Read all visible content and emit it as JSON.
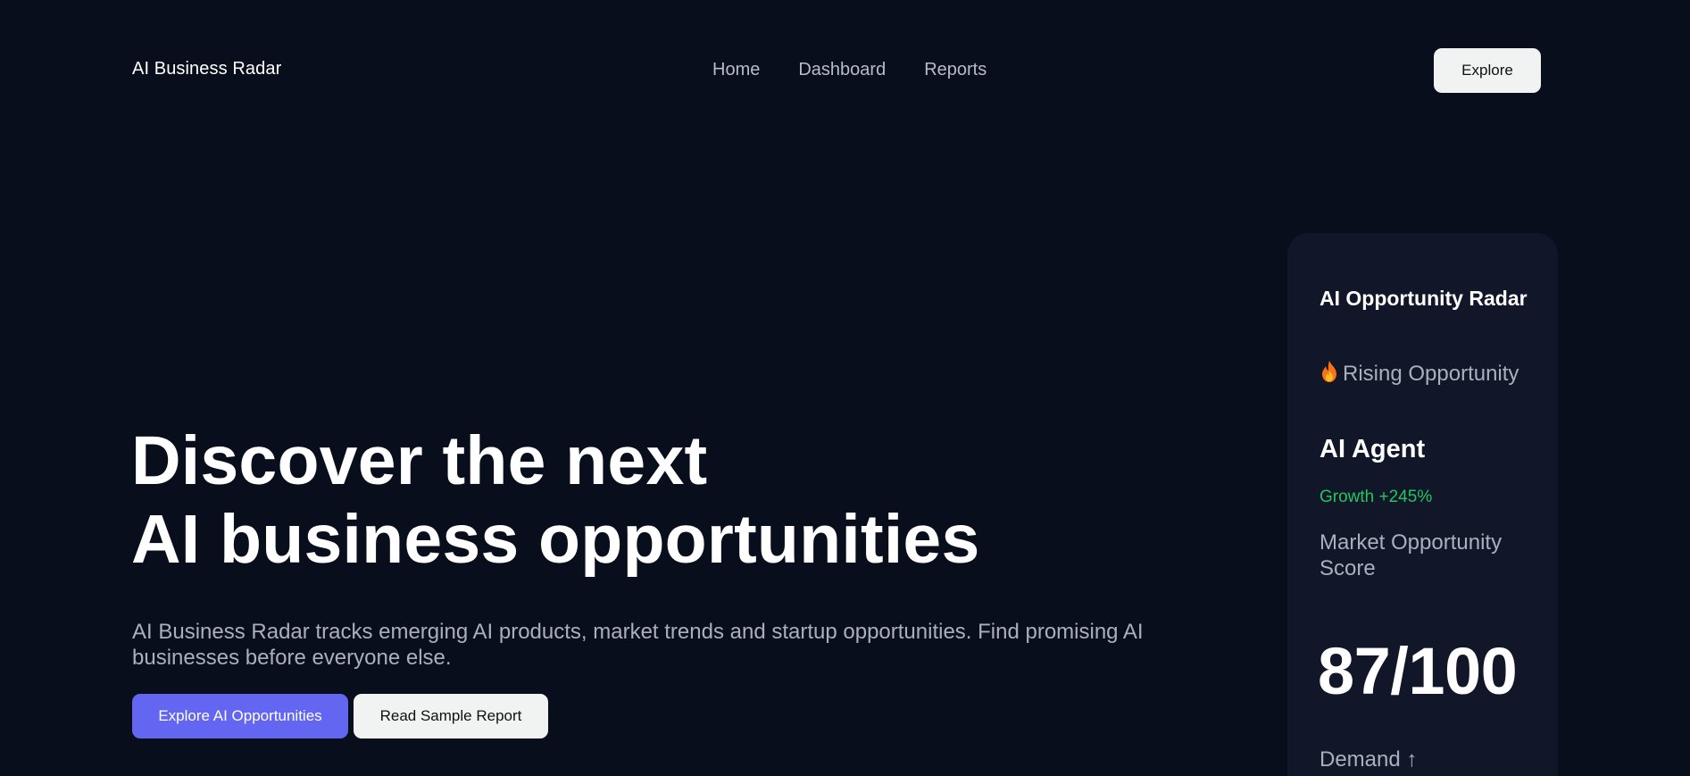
{
  "header": {
    "brand": "AI Business Radar",
    "nav": [
      "Home",
      "Dashboard",
      "Reports"
    ],
    "explore_label": "Explore"
  },
  "hero": {
    "title_line1": "Discover the next",
    "title_line2": "AI business opportunities",
    "subtitle": "AI Business Radar tracks emerging AI products, market trends and startup opportunities. Find promising AI businesses before everyone else.",
    "primary_cta": "Explore AI Opportunities",
    "secondary_cta": "Read Sample Report"
  },
  "card": {
    "title": "AI Opportunity Radar",
    "rising_icon": "fire-icon",
    "rising_label": "Rising Opportunity",
    "category": "AI Agent",
    "growth": "Growth +245%",
    "score_label": "Market Opportunity Score",
    "score": "87/100",
    "demand": "Demand ↑"
  },
  "colors": {
    "background": "#090e1c",
    "card_background": "#111629",
    "accent": "#6366f1",
    "growth_green": "#22c55e",
    "muted_text": "#aab0bb"
  }
}
